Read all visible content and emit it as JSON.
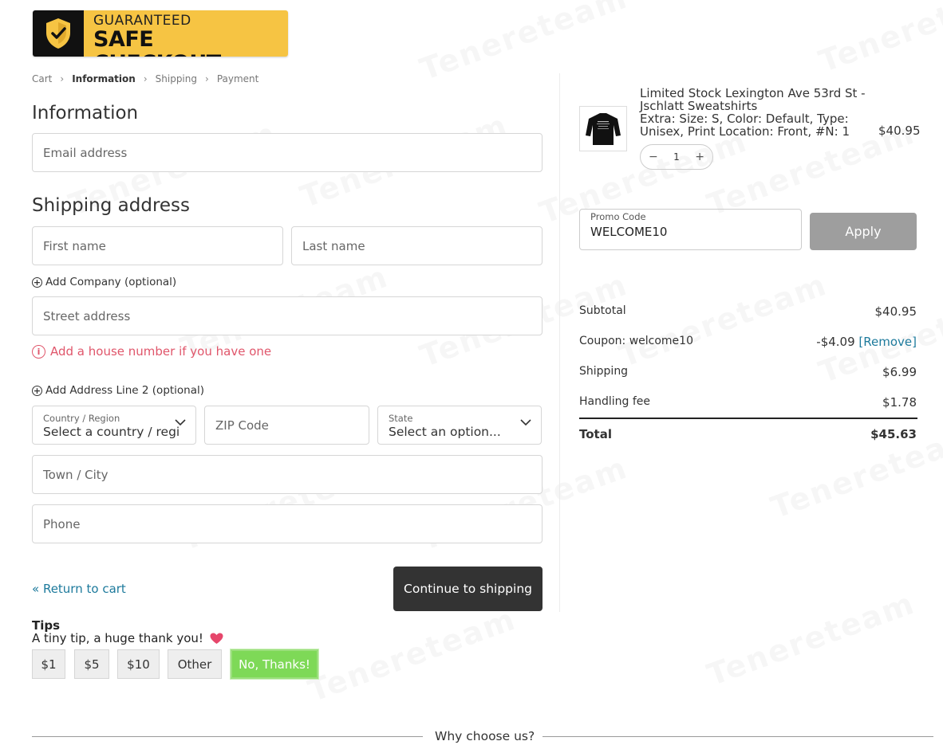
{
  "logo": {
    "top_text": "GUARANTEED",
    "main_text": "SAFE CHECKOUT"
  },
  "watermark_text": "Tenereteam",
  "breadcrumb": {
    "items": [
      "Cart",
      "Information",
      "Shipping",
      "Payment"
    ],
    "current_index": 1
  },
  "information": {
    "title": "Information",
    "email_placeholder": "Email address"
  },
  "shipping": {
    "title": "Shipping address",
    "first_name_placeholder": "First name",
    "last_name_placeholder": "Last name",
    "add_company_label": "Add Company (optional)",
    "street_placeholder": "Street address",
    "street_warning": "Add a house number if you have one",
    "add_line2_label": "Add Address Line 2 (optional)",
    "country": {
      "label": "Country / Region",
      "value": "Select a country / region..."
    },
    "zip_placeholder": "ZIP Code",
    "state": {
      "label": "State",
      "value": "Select an option..."
    },
    "city_placeholder": "Town / City",
    "phone_placeholder": "Phone"
  },
  "actions": {
    "return_label": "« Return to cart",
    "continue_label": "Continue to shipping"
  },
  "tips": {
    "title": "Tips",
    "subtitle": "A tiny tip, a huge thank you!",
    "heart_icon": "heart-icon",
    "options": [
      "$1",
      "$5",
      "$10",
      "Other",
      "No, Thanks!"
    ],
    "selected": "No, Thanks!"
  },
  "footer": {
    "why_label": "Why choose us?"
  },
  "cart": {
    "product_title": "Limited Stock Lexington Ave 53rd St - Jschlatt Sweatshirts",
    "product_variant": "Extra: Size: S, Color: Default, Type: Unisex, Print Location: Front, #N: 1",
    "price": "$40.95",
    "quantity": "1",
    "qty_minus": "−",
    "qty_plus": "+"
  },
  "promo": {
    "label": "Promo Code",
    "value": "WELCOME10",
    "apply_label": "Apply"
  },
  "summary": {
    "subtotal_label": "Subtotal",
    "subtotal_value": "$40.95",
    "coupon_label": "Coupon: welcome10",
    "coupon_value": "-$4.09",
    "coupon_remove": "[Remove]",
    "shipping_label": "Shipping",
    "shipping_value": "$6.99",
    "handling_label": "Handling fee",
    "handling_value": "$1.78",
    "total_label": "Total",
    "total_value": "$45.63"
  },
  "colors": {
    "accent_link": "#1d7a9c",
    "warning": "#e0566b",
    "logo_yellow": "#f6c443",
    "tip_selected": "#7ed957",
    "continue_bg": "#333333",
    "apply_bg": "#9e9e9e"
  }
}
